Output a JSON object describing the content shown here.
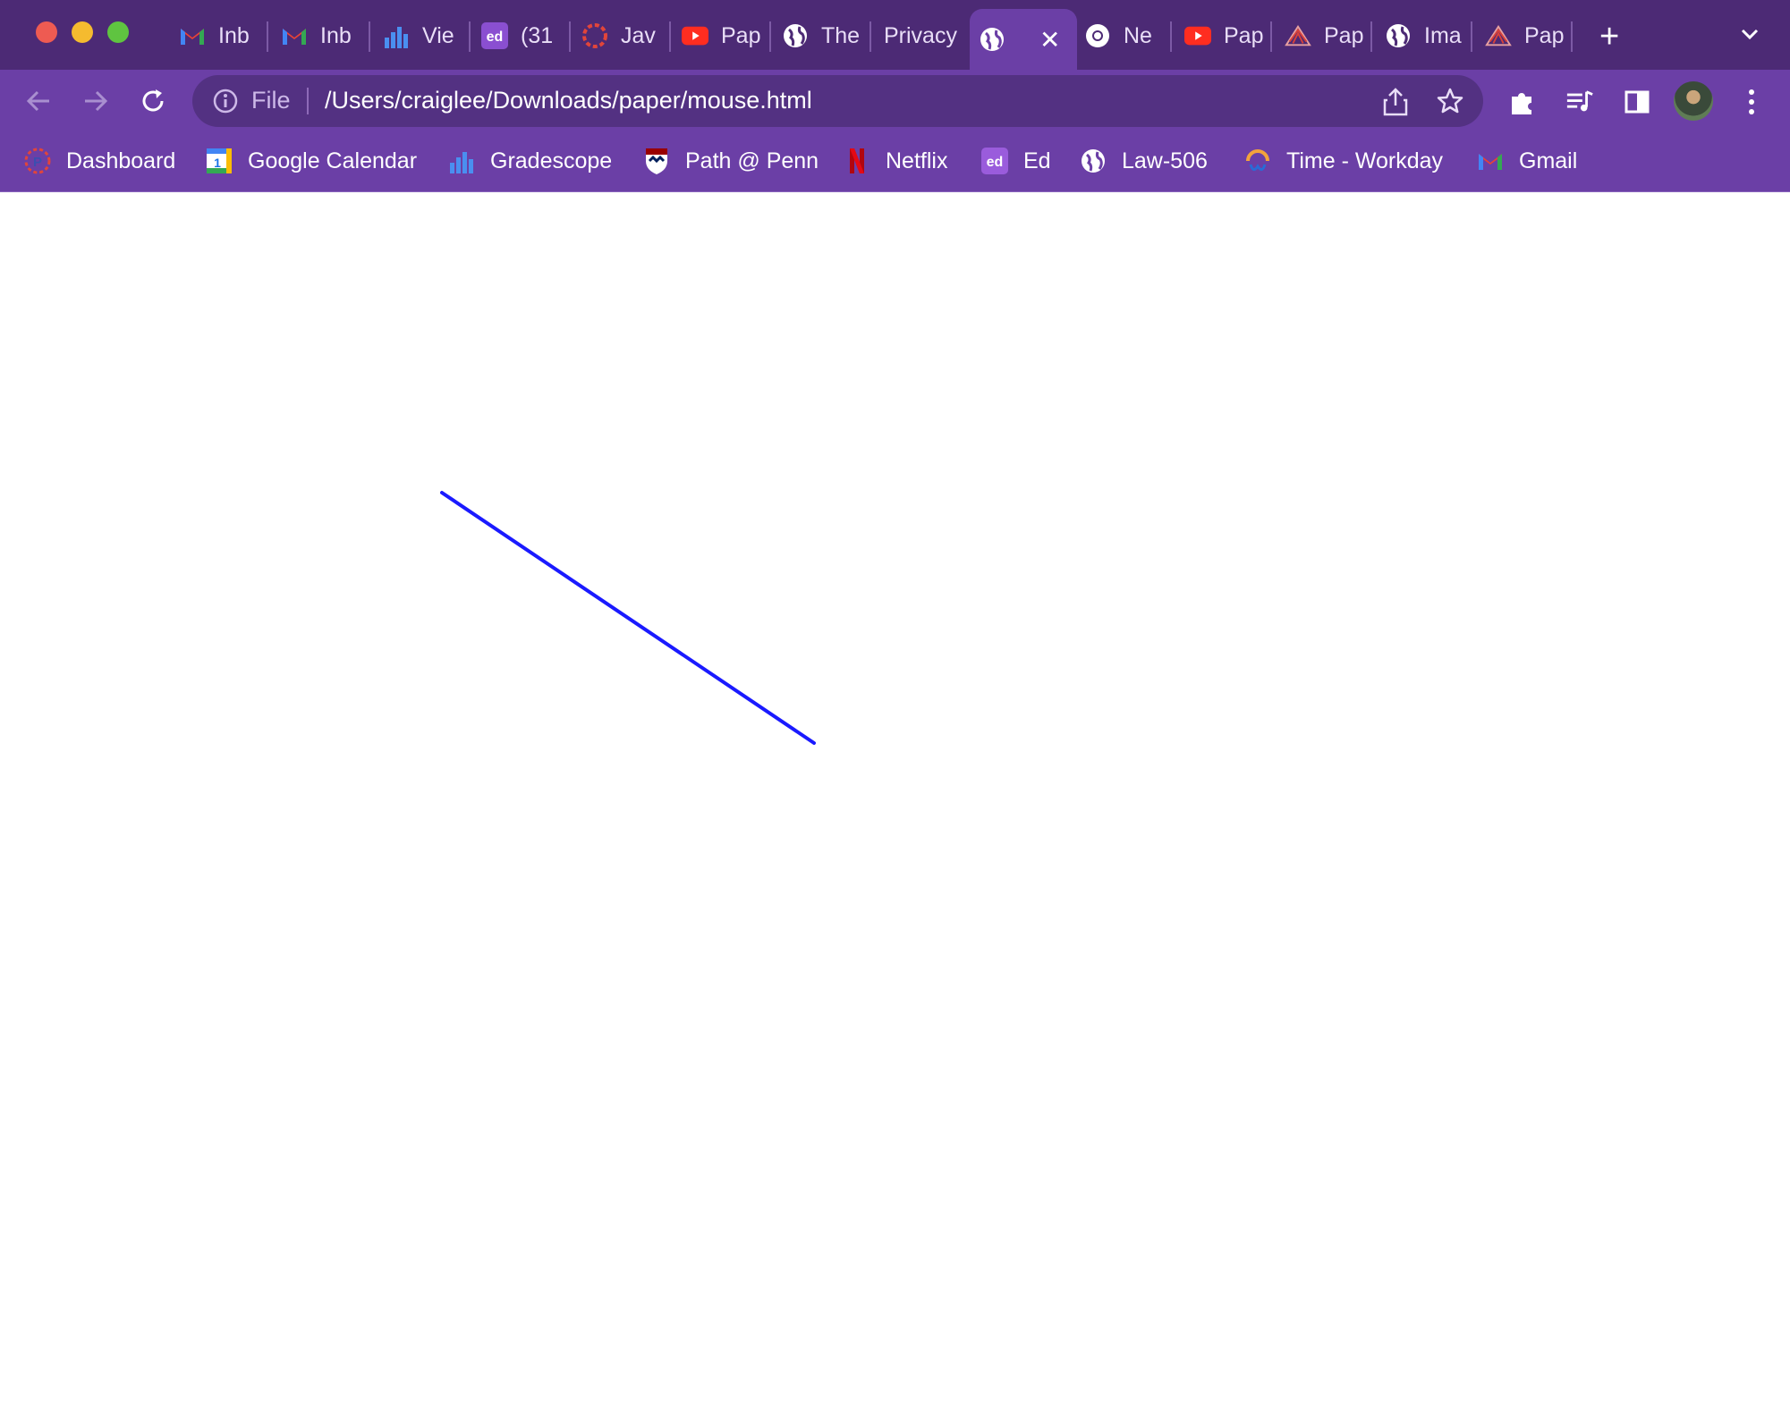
{
  "window": {
    "tabs": [
      {
        "label": "Inb",
        "icon": "gmail-icon"
      },
      {
        "label": "Inb",
        "icon": "gmail-icon"
      },
      {
        "label": "Vie",
        "icon": "gradescope-icon"
      },
      {
        "label": "(31",
        "icon": "ed-icon"
      },
      {
        "label": "Jav",
        "icon": "ring-icon"
      },
      {
        "label": "Pap",
        "icon": "youtube-icon"
      },
      {
        "label": "The",
        "icon": "globe-icon"
      },
      {
        "label": "Privacy",
        "icon": ""
      },
      {
        "label": "",
        "icon": "globe-icon",
        "active": true
      },
      {
        "label": "Ne",
        "icon": "chrome-icon"
      },
      {
        "label": "Pap",
        "icon": "youtube-icon"
      },
      {
        "label": "Pap",
        "icon": "fan-icon"
      },
      {
        "label": "Ima",
        "icon": "globe-icon"
      },
      {
        "label": "Pap",
        "icon": "fan-icon"
      }
    ]
  },
  "omnibox": {
    "scheme": "File",
    "url": "/Users/craiglee/Downloads/paper/mouse.html"
  },
  "bookmarks": [
    {
      "label": "Dashboard",
      "icon": "canvas-icon"
    },
    {
      "label": "Google Calendar",
      "icon": "calendar-icon"
    },
    {
      "label": "Gradescope",
      "icon": "gradescope-icon"
    },
    {
      "label": "Path @ Penn",
      "icon": "penn-shield-icon"
    },
    {
      "label": "Netflix",
      "icon": "netflix-icon"
    },
    {
      "label": "Ed",
      "icon": "ed-icon"
    },
    {
      "label": "Law-506",
      "icon": "globe-icon"
    },
    {
      "label": "Time - Workday",
      "icon": "workday-icon"
    },
    {
      "label": "Gmail",
      "icon": "gmail-icon"
    }
  ],
  "colors": {
    "tabstrip": "#4c2a75",
    "toolbar": "#6b3fa6",
    "drawn_line": "#1a1aff"
  }
}
